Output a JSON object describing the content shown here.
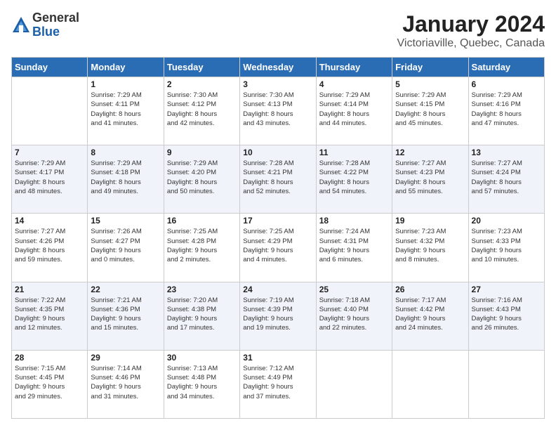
{
  "logo": {
    "general": "General",
    "blue": "Blue"
  },
  "title": "January 2024",
  "subtitle": "Victoriaville, Quebec, Canada",
  "days_of_week": [
    "Sunday",
    "Monday",
    "Tuesday",
    "Wednesday",
    "Thursday",
    "Friday",
    "Saturday"
  ],
  "weeks": [
    [
      {
        "day": "",
        "info": ""
      },
      {
        "day": "1",
        "info": "Sunrise: 7:29 AM\nSunset: 4:11 PM\nDaylight: 8 hours\nand 41 minutes."
      },
      {
        "day": "2",
        "info": "Sunrise: 7:30 AM\nSunset: 4:12 PM\nDaylight: 8 hours\nand 42 minutes."
      },
      {
        "day": "3",
        "info": "Sunrise: 7:30 AM\nSunset: 4:13 PM\nDaylight: 8 hours\nand 43 minutes."
      },
      {
        "day": "4",
        "info": "Sunrise: 7:29 AM\nSunset: 4:14 PM\nDaylight: 8 hours\nand 44 minutes."
      },
      {
        "day": "5",
        "info": "Sunrise: 7:29 AM\nSunset: 4:15 PM\nDaylight: 8 hours\nand 45 minutes."
      },
      {
        "day": "6",
        "info": "Sunrise: 7:29 AM\nSunset: 4:16 PM\nDaylight: 8 hours\nand 47 minutes."
      }
    ],
    [
      {
        "day": "7",
        "info": "Sunrise: 7:29 AM\nSunset: 4:17 PM\nDaylight: 8 hours\nand 48 minutes."
      },
      {
        "day": "8",
        "info": "Sunrise: 7:29 AM\nSunset: 4:18 PM\nDaylight: 8 hours\nand 49 minutes."
      },
      {
        "day": "9",
        "info": "Sunrise: 7:29 AM\nSunset: 4:20 PM\nDaylight: 8 hours\nand 50 minutes."
      },
      {
        "day": "10",
        "info": "Sunrise: 7:28 AM\nSunset: 4:21 PM\nDaylight: 8 hours\nand 52 minutes."
      },
      {
        "day": "11",
        "info": "Sunrise: 7:28 AM\nSunset: 4:22 PM\nDaylight: 8 hours\nand 54 minutes."
      },
      {
        "day": "12",
        "info": "Sunrise: 7:27 AM\nSunset: 4:23 PM\nDaylight: 8 hours\nand 55 minutes."
      },
      {
        "day": "13",
        "info": "Sunrise: 7:27 AM\nSunset: 4:24 PM\nDaylight: 8 hours\nand 57 minutes."
      }
    ],
    [
      {
        "day": "14",
        "info": "Sunrise: 7:27 AM\nSunset: 4:26 PM\nDaylight: 8 hours\nand 59 minutes."
      },
      {
        "day": "15",
        "info": "Sunrise: 7:26 AM\nSunset: 4:27 PM\nDaylight: 9 hours\nand 0 minutes."
      },
      {
        "day": "16",
        "info": "Sunrise: 7:25 AM\nSunset: 4:28 PM\nDaylight: 9 hours\nand 2 minutes."
      },
      {
        "day": "17",
        "info": "Sunrise: 7:25 AM\nSunset: 4:29 PM\nDaylight: 9 hours\nand 4 minutes."
      },
      {
        "day": "18",
        "info": "Sunrise: 7:24 AM\nSunset: 4:31 PM\nDaylight: 9 hours\nand 6 minutes."
      },
      {
        "day": "19",
        "info": "Sunrise: 7:23 AM\nSunset: 4:32 PM\nDaylight: 9 hours\nand 8 minutes."
      },
      {
        "day": "20",
        "info": "Sunrise: 7:23 AM\nSunset: 4:33 PM\nDaylight: 9 hours\nand 10 minutes."
      }
    ],
    [
      {
        "day": "21",
        "info": "Sunrise: 7:22 AM\nSunset: 4:35 PM\nDaylight: 9 hours\nand 12 minutes."
      },
      {
        "day": "22",
        "info": "Sunrise: 7:21 AM\nSunset: 4:36 PM\nDaylight: 9 hours\nand 15 minutes."
      },
      {
        "day": "23",
        "info": "Sunrise: 7:20 AM\nSunset: 4:38 PM\nDaylight: 9 hours\nand 17 minutes."
      },
      {
        "day": "24",
        "info": "Sunrise: 7:19 AM\nSunset: 4:39 PM\nDaylight: 9 hours\nand 19 minutes."
      },
      {
        "day": "25",
        "info": "Sunrise: 7:18 AM\nSunset: 4:40 PM\nDaylight: 9 hours\nand 22 minutes."
      },
      {
        "day": "26",
        "info": "Sunrise: 7:17 AM\nSunset: 4:42 PM\nDaylight: 9 hours\nand 24 minutes."
      },
      {
        "day": "27",
        "info": "Sunrise: 7:16 AM\nSunset: 4:43 PM\nDaylight: 9 hours\nand 26 minutes."
      }
    ],
    [
      {
        "day": "28",
        "info": "Sunrise: 7:15 AM\nSunset: 4:45 PM\nDaylight: 9 hours\nand 29 minutes."
      },
      {
        "day": "29",
        "info": "Sunrise: 7:14 AM\nSunset: 4:46 PM\nDaylight: 9 hours\nand 31 minutes."
      },
      {
        "day": "30",
        "info": "Sunrise: 7:13 AM\nSunset: 4:48 PM\nDaylight: 9 hours\nand 34 minutes."
      },
      {
        "day": "31",
        "info": "Sunrise: 7:12 AM\nSunset: 4:49 PM\nDaylight: 9 hours\nand 37 minutes."
      },
      {
        "day": "",
        "info": ""
      },
      {
        "day": "",
        "info": ""
      },
      {
        "day": "",
        "info": ""
      }
    ]
  ]
}
